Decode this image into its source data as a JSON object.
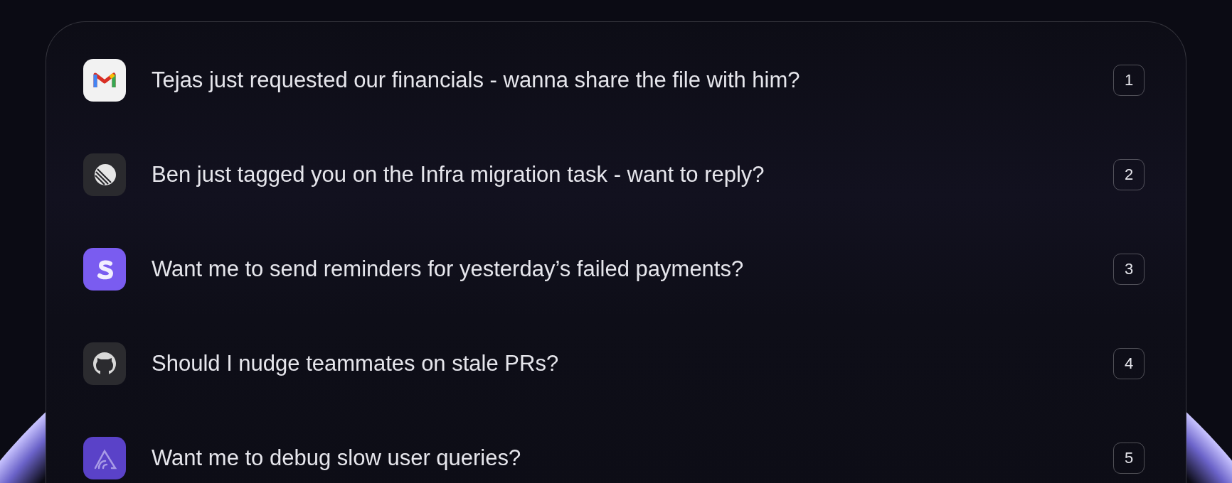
{
  "suggestions": [
    {
      "kind": "gmail",
      "text": "Tejas just requested our financials - wanna share the file with him?",
      "shortcut": "1"
    },
    {
      "kind": "linear",
      "text": "Ben just tagged you on the Infra migration task - want to reply?",
      "shortcut": "2"
    },
    {
      "kind": "stripe",
      "text": "Want me to send reminders for yesterday’s failed payments?",
      "shortcut": "3"
    },
    {
      "kind": "github",
      "text": "Should I nudge teammates on stale PRs?",
      "shortcut": "4"
    },
    {
      "kind": "sentry",
      "text": "Want me to debug slow user queries?",
      "shortcut": "5"
    }
  ]
}
